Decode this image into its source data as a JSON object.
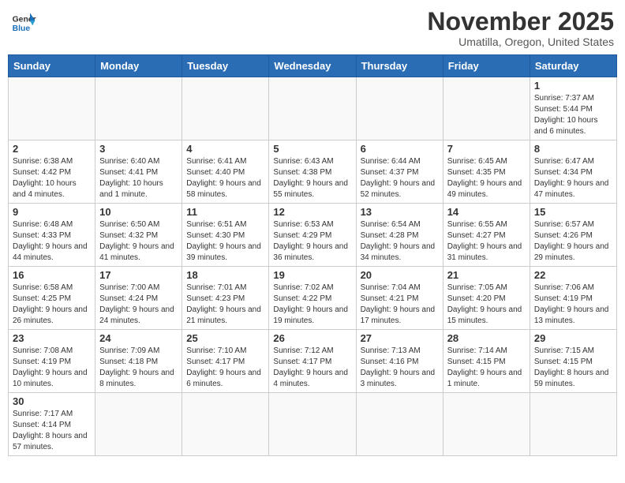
{
  "header": {
    "logo_line1": "General",
    "logo_line2": "Blue",
    "month_title": "November 2025",
    "location": "Umatilla, Oregon, United States"
  },
  "weekdays": [
    "Sunday",
    "Monday",
    "Tuesday",
    "Wednesday",
    "Thursday",
    "Friday",
    "Saturday"
  ],
  "weeks": [
    [
      {
        "day": "",
        "info": ""
      },
      {
        "day": "",
        "info": ""
      },
      {
        "day": "",
        "info": ""
      },
      {
        "day": "",
        "info": ""
      },
      {
        "day": "",
        "info": ""
      },
      {
        "day": "",
        "info": ""
      },
      {
        "day": "1",
        "info": "Sunrise: 7:37 AM\nSunset: 5:44 PM\nDaylight: 10 hours and 6 minutes."
      }
    ],
    [
      {
        "day": "2",
        "info": "Sunrise: 6:38 AM\nSunset: 4:42 PM\nDaylight: 10 hours and 4 minutes."
      },
      {
        "day": "3",
        "info": "Sunrise: 6:40 AM\nSunset: 4:41 PM\nDaylight: 10 hours and 1 minute."
      },
      {
        "day": "4",
        "info": "Sunrise: 6:41 AM\nSunset: 4:40 PM\nDaylight: 9 hours and 58 minutes."
      },
      {
        "day": "5",
        "info": "Sunrise: 6:43 AM\nSunset: 4:38 PM\nDaylight: 9 hours and 55 minutes."
      },
      {
        "day": "6",
        "info": "Sunrise: 6:44 AM\nSunset: 4:37 PM\nDaylight: 9 hours and 52 minutes."
      },
      {
        "day": "7",
        "info": "Sunrise: 6:45 AM\nSunset: 4:35 PM\nDaylight: 9 hours and 49 minutes."
      },
      {
        "day": "8",
        "info": "Sunrise: 6:47 AM\nSunset: 4:34 PM\nDaylight: 9 hours and 47 minutes."
      }
    ],
    [
      {
        "day": "9",
        "info": "Sunrise: 6:48 AM\nSunset: 4:33 PM\nDaylight: 9 hours and 44 minutes."
      },
      {
        "day": "10",
        "info": "Sunrise: 6:50 AM\nSunset: 4:32 PM\nDaylight: 9 hours and 41 minutes."
      },
      {
        "day": "11",
        "info": "Sunrise: 6:51 AM\nSunset: 4:30 PM\nDaylight: 9 hours and 39 minutes."
      },
      {
        "day": "12",
        "info": "Sunrise: 6:53 AM\nSunset: 4:29 PM\nDaylight: 9 hours and 36 minutes."
      },
      {
        "day": "13",
        "info": "Sunrise: 6:54 AM\nSunset: 4:28 PM\nDaylight: 9 hours and 34 minutes."
      },
      {
        "day": "14",
        "info": "Sunrise: 6:55 AM\nSunset: 4:27 PM\nDaylight: 9 hours and 31 minutes."
      },
      {
        "day": "15",
        "info": "Sunrise: 6:57 AM\nSunset: 4:26 PM\nDaylight: 9 hours and 29 minutes."
      }
    ],
    [
      {
        "day": "16",
        "info": "Sunrise: 6:58 AM\nSunset: 4:25 PM\nDaylight: 9 hours and 26 minutes."
      },
      {
        "day": "17",
        "info": "Sunrise: 7:00 AM\nSunset: 4:24 PM\nDaylight: 9 hours and 24 minutes."
      },
      {
        "day": "18",
        "info": "Sunrise: 7:01 AM\nSunset: 4:23 PM\nDaylight: 9 hours and 21 minutes."
      },
      {
        "day": "19",
        "info": "Sunrise: 7:02 AM\nSunset: 4:22 PM\nDaylight: 9 hours and 19 minutes."
      },
      {
        "day": "20",
        "info": "Sunrise: 7:04 AM\nSunset: 4:21 PM\nDaylight: 9 hours and 17 minutes."
      },
      {
        "day": "21",
        "info": "Sunrise: 7:05 AM\nSunset: 4:20 PM\nDaylight: 9 hours and 15 minutes."
      },
      {
        "day": "22",
        "info": "Sunrise: 7:06 AM\nSunset: 4:19 PM\nDaylight: 9 hours and 13 minutes."
      }
    ],
    [
      {
        "day": "23",
        "info": "Sunrise: 7:08 AM\nSunset: 4:19 PM\nDaylight: 9 hours and 10 minutes."
      },
      {
        "day": "24",
        "info": "Sunrise: 7:09 AM\nSunset: 4:18 PM\nDaylight: 9 hours and 8 minutes."
      },
      {
        "day": "25",
        "info": "Sunrise: 7:10 AM\nSunset: 4:17 PM\nDaylight: 9 hours and 6 minutes."
      },
      {
        "day": "26",
        "info": "Sunrise: 7:12 AM\nSunset: 4:17 PM\nDaylight: 9 hours and 4 minutes."
      },
      {
        "day": "27",
        "info": "Sunrise: 7:13 AM\nSunset: 4:16 PM\nDaylight: 9 hours and 3 minutes."
      },
      {
        "day": "28",
        "info": "Sunrise: 7:14 AM\nSunset: 4:15 PM\nDaylight: 9 hours and 1 minute."
      },
      {
        "day": "29",
        "info": "Sunrise: 7:15 AM\nSunset: 4:15 PM\nDaylight: 8 hours and 59 minutes."
      }
    ],
    [
      {
        "day": "30",
        "info": "Sunrise: 7:17 AM\nSunset: 4:14 PM\nDaylight: 8 hours and 57 minutes."
      },
      {
        "day": "",
        "info": ""
      },
      {
        "day": "",
        "info": ""
      },
      {
        "day": "",
        "info": ""
      },
      {
        "day": "",
        "info": ""
      },
      {
        "day": "",
        "info": ""
      },
      {
        "day": "",
        "info": ""
      }
    ]
  ]
}
